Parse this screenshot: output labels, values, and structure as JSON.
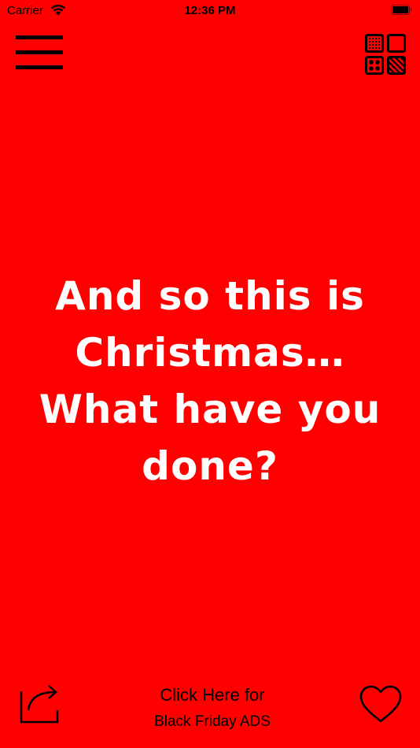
{
  "status_bar": {
    "carrier": "Carrier",
    "time": "12:36 PM"
  },
  "quote": {
    "text": "And so this is Christmas… What have you done?",
    "color": "#ffffff"
  },
  "ads": {
    "line1": "Click Here for",
    "line2": "Black Friday ADS"
  },
  "theme": {
    "background": "#fe0000",
    "icon_color": "#000000"
  },
  "icons": {
    "menu": "hamburger-menu-icon",
    "grid": "background-patterns-grid-icon",
    "share": "share-icon",
    "favorite": "heart-icon"
  }
}
